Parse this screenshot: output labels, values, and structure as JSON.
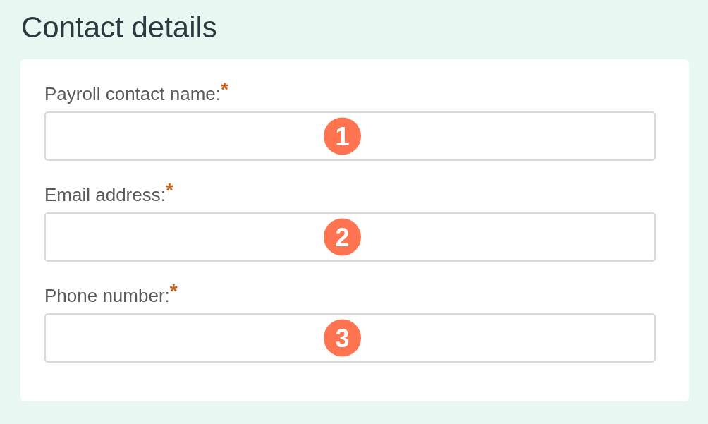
{
  "title": "Contact details",
  "form": {
    "fields": [
      {
        "label": "Payroll contact name:",
        "required_mark": "*",
        "marker": "1"
      },
      {
        "label": "Email address:",
        "required_mark": "*",
        "marker": "2"
      },
      {
        "label": "Phone number:",
        "required_mark": "*",
        "marker": "3"
      }
    ]
  }
}
